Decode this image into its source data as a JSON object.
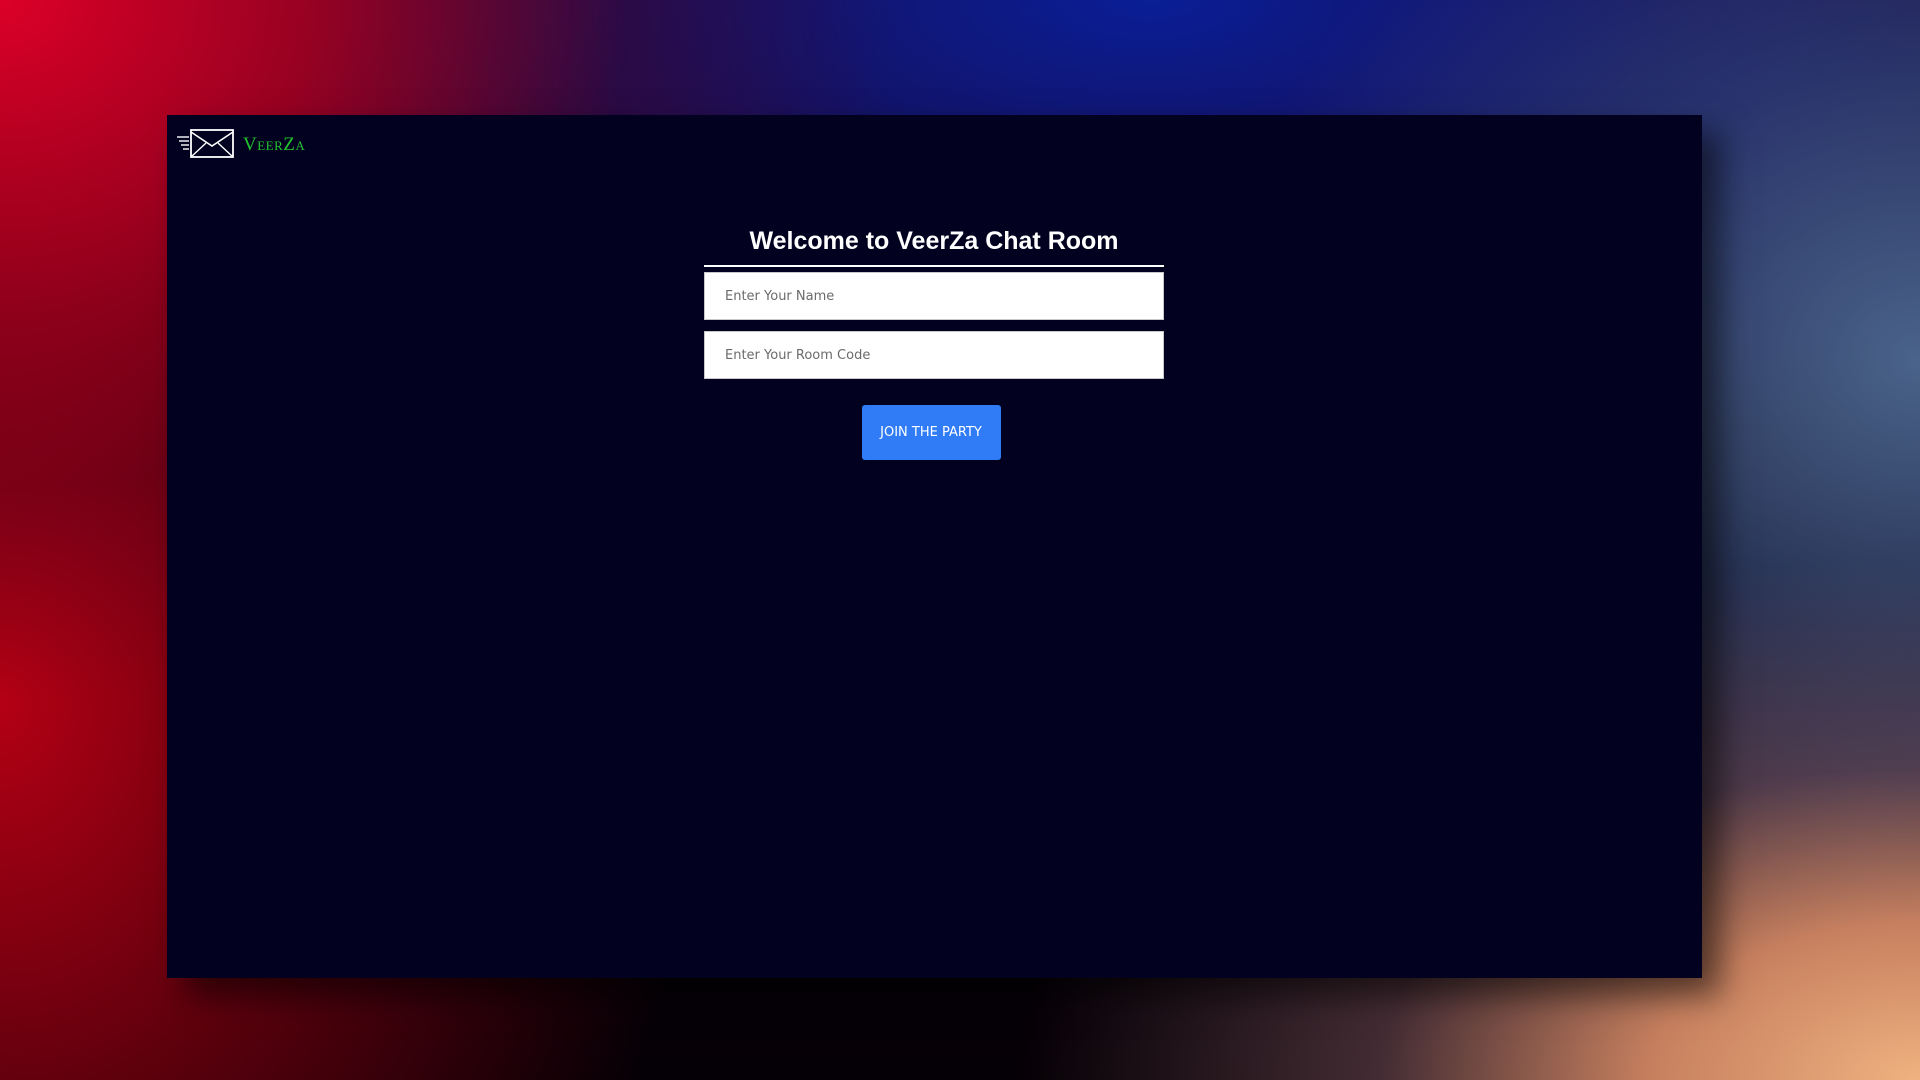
{
  "brand": {
    "name": "VeerZa",
    "icon": "envelope-icon"
  },
  "join_form": {
    "title": "Welcome to VeerZa Chat Room",
    "name_placeholder": "Enter Your Name",
    "room_placeholder": "Enter Your Room Code",
    "name_value": "",
    "room_value": "",
    "submit_label": "JOIN THE PARTY"
  },
  "colors": {
    "window_background": "#020220",
    "brand_text": "#22c52e",
    "button_background": "#2f7cf6",
    "title_text": "#ffffff"
  }
}
